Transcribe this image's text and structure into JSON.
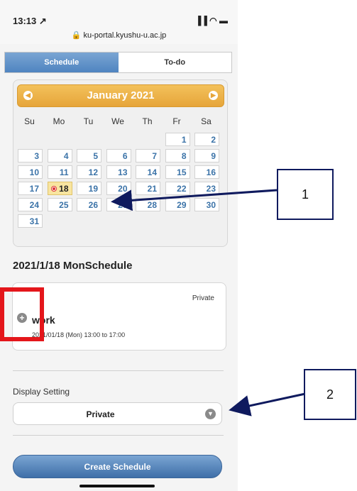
{
  "status_bar": {
    "time": "13:13 ↗",
    "icons": "▐▐ ◠ ▬",
    "url": "🔒 ku-portal.kyushu-u.ac.jp"
  },
  "tabs": [
    {
      "label": "Schedule",
      "active": true
    },
    {
      "label": "To-do",
      "active": false
    }
  ],
  "calendar": {
    "title": "January 2021",
    "prev_icon": "◀",
    "next_icon": "▶",
    "weekdays": [
      "Su",
      "Mo",
      "Tu",
      "We",
      "Th",
      "Fr",
      "Sa"
    ],
    "weeks": [
      [
        "",
        "",
        "",
        "",
        "",
        "1",
        "2"
      ],
      [
        "3",
        "4",
        "5",
        "6",
        "7",
        "8",
        "9"
      ],
      [
        "10",
        "11",
        "12",
        "13",
        "14",
        "15",
        "16"
      ],
      [
        "17",
        "18",
        "19",
        "20",
        "21",
        "22",
        "23"
      ],
      [
        "24",
        "25",
        "26",
        "27",
        "28",
        "29",
        "30"
      ],
      [
        "31",
        "",
        "",
        "",
        "",
        "",
        ""
      ]
    ],
    "selected": "18"
  },
  "schedule": {
    "heading": "2021/1/18 MonSchedule",
    "event": {
      "visibility": "Private",
      "title": "work",
      "time": "2021/01/18 (Mon) 13:00 to 17:00"
    }
  },
  "display_setting": {
    "label": "Display Setting",
    "value": "Private"
  },
  "create_button": "Create Schedule",
  "callouts": [
    "1",
    "2"
  ],
  "colors": {
    "accent_blue": "#4f84c0",
    "calendar_header": "#e6a53a",
    "annotation_red": "#e4161b",
    "annotation_navy": "#0f1a5e"
  }
}
